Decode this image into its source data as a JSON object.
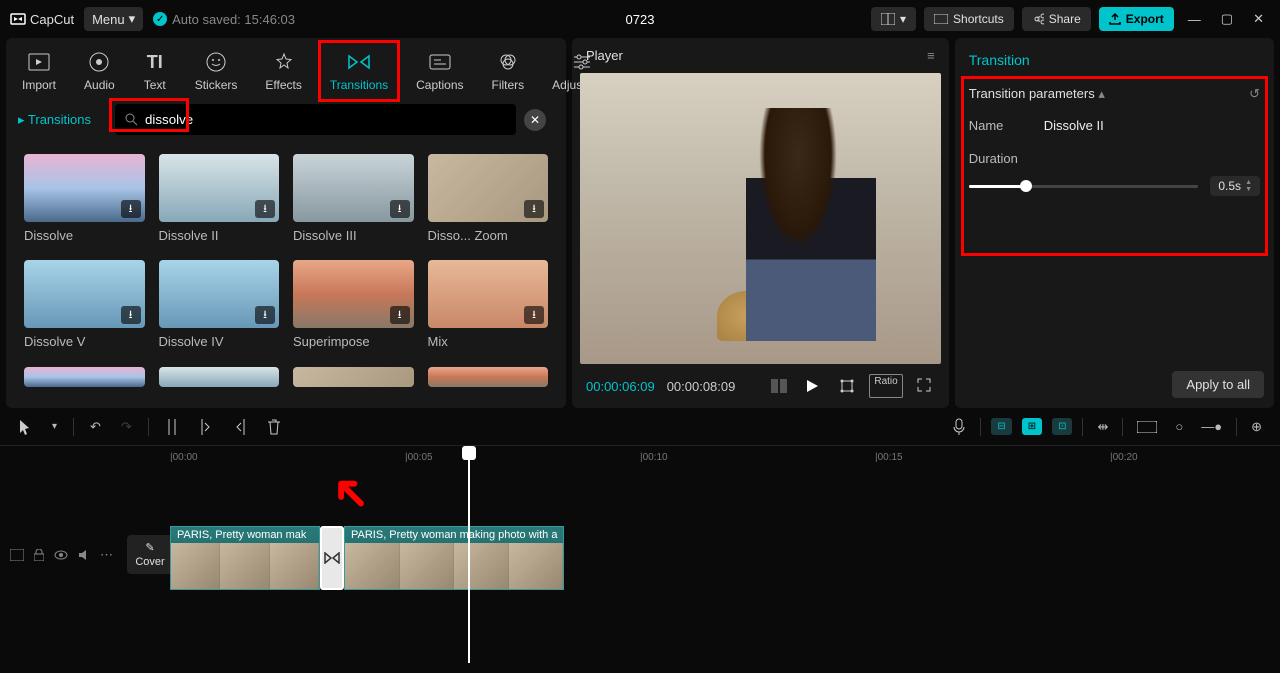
{
  "titlebar": {
    "logo": "CapCut",
    "menu": "Menu",
    "autosaved": "Auto saved: 15:46:03",
    "project_title": "0723",
    "shortcuts": "Shortcuts",
    "share": "Share",
    "export": "Export"
  },
  "tabs": {
    "import": "Import",
    "audio": "Audio",
    "text": "Text",
    "stickers": "Stickers",
    "effects": "Effects",
    "transitions": "Transitions",
    "captions": "Captions",
    "filters": "Filters",
    "adjustment": "Adjustment"
  },
  "side_tab": "Transitions",
  "search": {
    "value": "dissolve"
  },
  "grid": [
    {
      "label": "Dissolve"
    },
    {
      "label": "Dissolve II"
    },
    {
      "label": "Dissolve III"
    },
    {
      "label": "Disso... Zoom"
    },
    {
      "label": "Dissolve V"
    },
    {
      "label": "Dissolve IV"
    },
    {
      "label": "Superimpose"
    },
    {
      "label": "Mix"
    }
  ],
  "player": {
    "title": "Player",
    "time_current": "00:00:06:09",
    "time_total": "00:00:08:09",
    "ratio": "Ratio"
  },
  "right": {
    "title": "Transition",
    "section": "Transition parameters",
    "name_label": "Name",
    "name_value": "Dissolve II",
    "duration_label": "Duration",
    "duration_value": "0.5s",
    "apply": "Apply to all"
  },
  "timeline": {
    "ticks": [
      "|00:00",
      "|00:05",
      "|00:10",
      "|00:15",
      "|00:20"
    ],
    "cover": "Cover",
    "clip1": "PARIS, Pretty woman mak",
    "clip2": "PARIS, Pretty woman making photo with a"
  }
}
